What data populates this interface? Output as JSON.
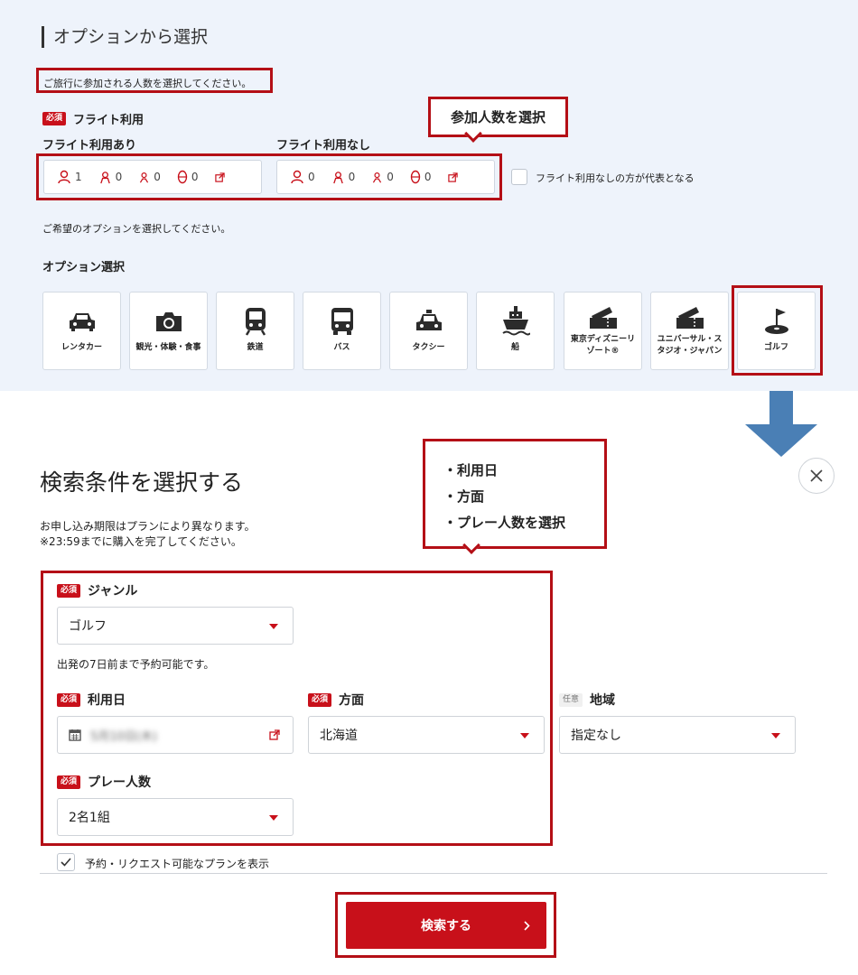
{
  "options_section": {
    "title": "オプションから選択",
    "pax_prompt": "ご旅行に参加される人数を選択してください。",
    "required_badge": "必須",
    "flight_heading": "フライト利用",
    "flight_yes_label": "フライト利用あり",
    "flight_no_label": "フライト利用なし",
    "flight_yes_counts": [
      "1",
      "0",
      "0",
      "0"
    ],
    "flight_no_counts": [
      "0",
      "0",
      "0",
      "0"
    ],
    "representative_checkbox_label": "フライト利用なしの方が代表となる",
    "option_prompt": "ご希望のオプションを選択してください。",
    "option_select_heading": "オプション選択",
    "tiles": [
      {
        "label": "レンタカー",
        "icon": "car-icon"
      },
      {
        "label": "観光・体験・食事",
        "icon": "camera-icon"
      },
      {
        "label": "鉄道",
        "icon": "train-icon"
      },
      {
        "label": "バス",
        "icon": "bus-icon"
      },
      {
        "label": "タクシー",
        "icon": "taxi-icon"
      },
      {
        "label": "船",
        "icon": "ship-icon"
      },
      {
        "label": "東京ディズニーリ\nゾート®",
        "icon": "ticket-icon"
      },
      {
        "label": "ユニバーサル・ス\nタジオ・ジャパン",
        "icon": "ticket-icon"
      },
      {
        "label": "ゴルフ",
        "icon": "golf-flag-icon"
      }
    ]
  },
  "callouts": {
    "top": "参加人数を選択",
    "bottom": [
      "・利用日",
      "・方面",
      "・プレー人数を選択"
    ]
  },
  "search_section": {
    "title": "検索条件を選択する",
    "note_line1": "お申し込み期限はプランにより異なります。",
    "note_line2": "※23:59までに購入を完了してください。",
    "required_badge": "必須",
    "optional_badge": "任意",
    "genre_label": "ジャンル",
    "genre_value": "ゴルフ",
    "genre_hint": "出発の7日前まで予約可能です。",
    "date_label": "利用日",
    "date_value": "5月10日(木)",
    "direction_label": "方面",
    "direction_value": "北海道",
    "region_label": "地域",
    "region_value": "指定なし",
    "players_label": "プレー人数",
    "players_value": "2名1組",
    "available_checkbox_label": "予約・リクエスト可能なプランを表示",
    "search_button": "検索する"
  },
  "colors": {
    "accent": "#c8101a",
    "arrow": "#4a7fb5",
    "panel": "#eef3fb"
  }
}
